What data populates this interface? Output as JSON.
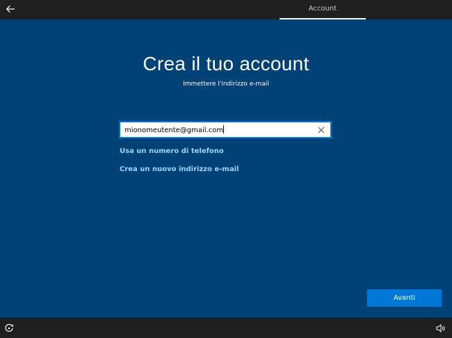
{
  "top_bar": {
    "back_icon": "back-arrow-icon",
    "active_tab": "Account"
  },
  "main": {
    "title": "Crea il tuo account",
    "subtitle": "Immettere l'indirizzo e-mail",
    "email_input": {
      "value": "mionomeutente@gmail.com",
      "clear_icon": "close-icon"
    },
    "links": {
      "phone": "Usa un numero di telefono",
      "new_email": "Crea un nuovo indirizzo e-mail"
    },
    "next_button": "Avanti"
  },
  "bottom_bar": {
    "ease_of_access_icon": "ease-of-access-icon",
    "volume_icon": "volume-icon"
  },
  "colors": {
    "background": "#004275",
    "bars": "#1f1f1f",
    "accent": "#0078d7",
    "link": "#9fd4ff"
  }
}
